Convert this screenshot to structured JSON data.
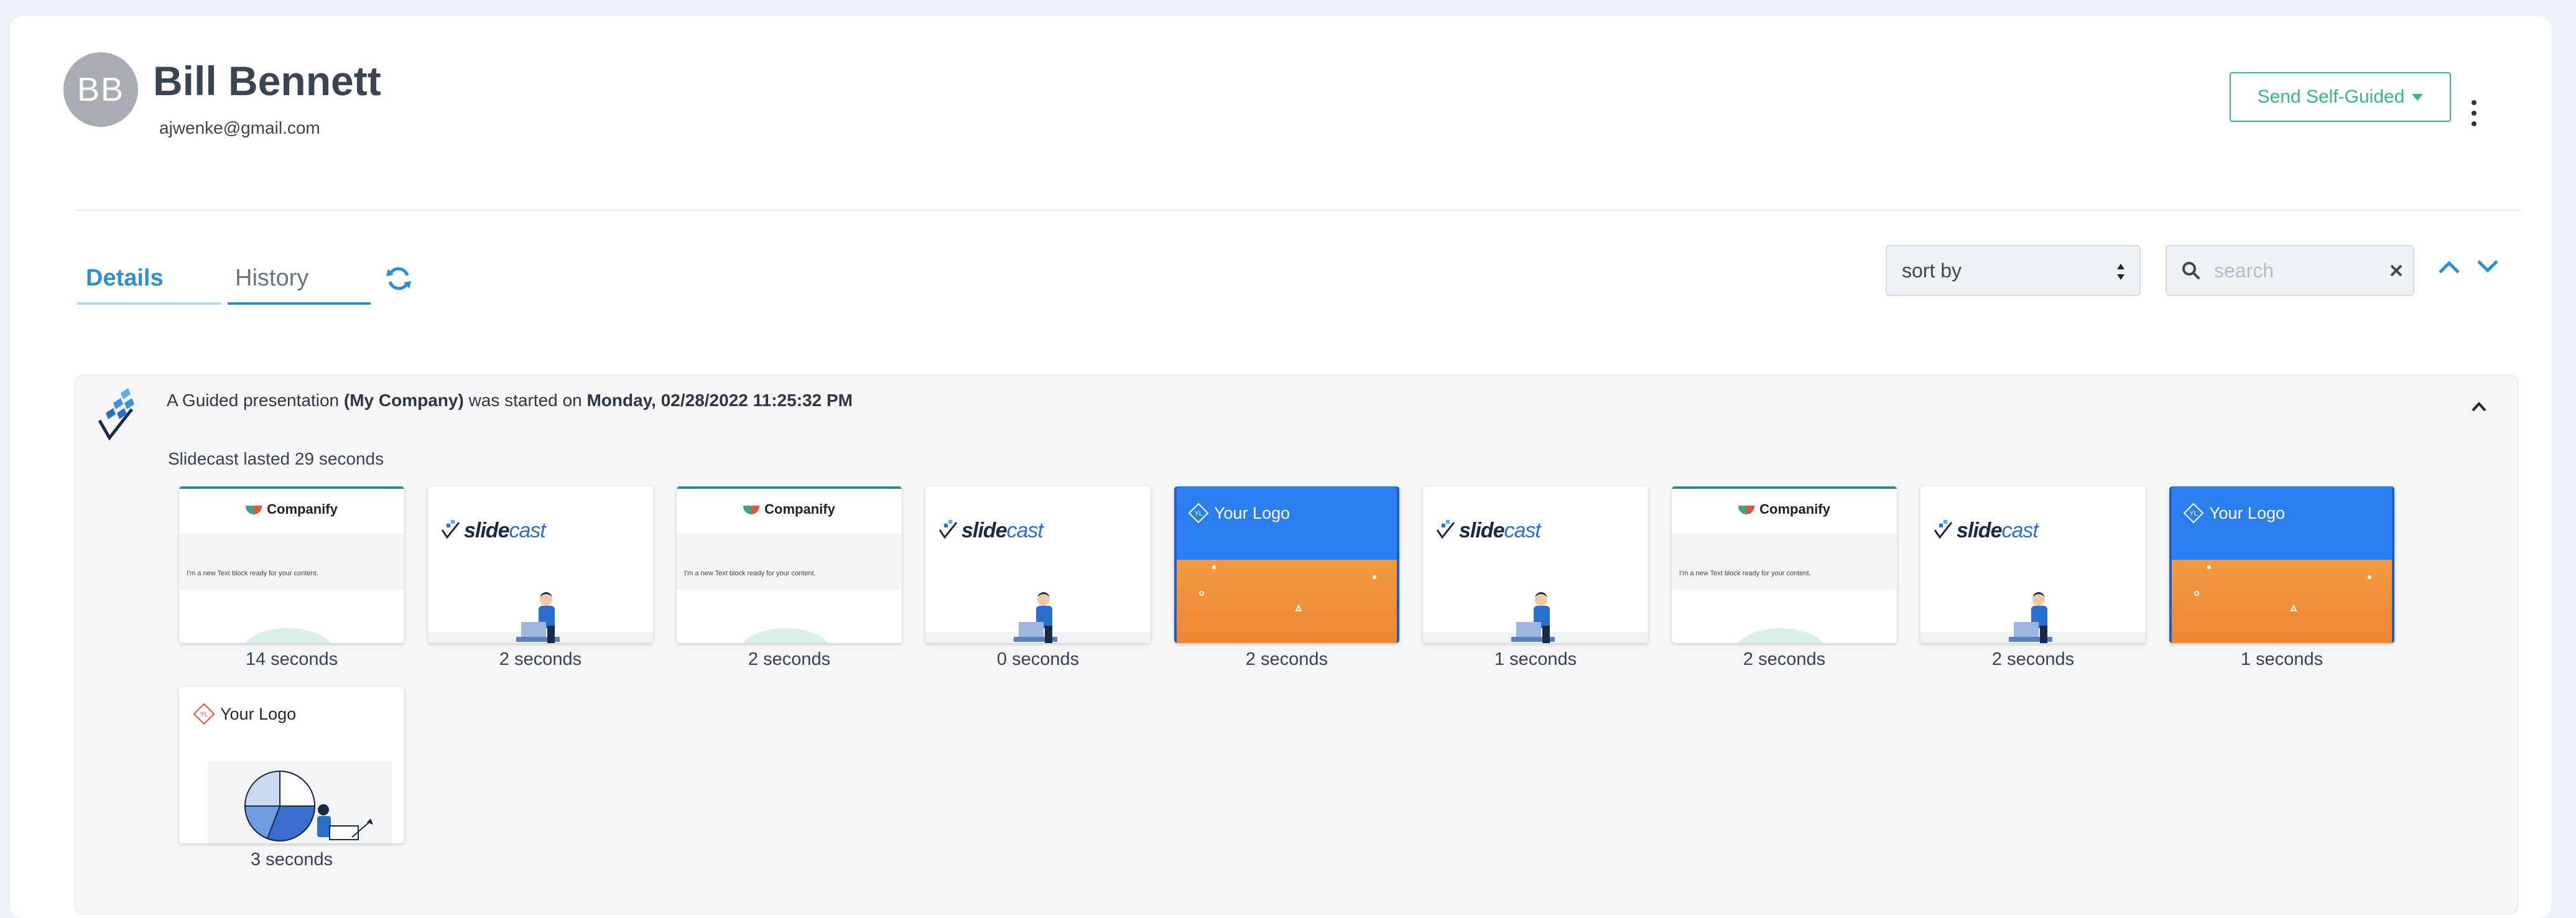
{
  "user": {
    "initials": "BB",
    "name": "Bill Bennett",
    "email": "ajwenke@gmail.com"
  },
  "header": {
    "send_button_label": "Send Self-Guided",
    "more_icon": "kebab-vertical-icon"
  },
  "tabs": [
    {
      "label": "Details",
      "active": false
    },
    {
      "label": "History",
      "active": true
    }
  ],
  "toolbar": {
    "refresh_icon": "refresh-icon",
    "sort": {
      "selected": "sort by"
    },
    "search": {
      "value": "",
      "placeholder": "search"
    }
  },
  "activity": {
    "prefix": "A Guided presentation",
    "company": "(My Company)",
    "middle": "was started on",
    "datetime": "Monday, 02/28/2022 11:25:32 PM",
    "duration": "Slidecast lasted 29 seconds",
    "slides": [
      {
        "type": "companify",
        "label": "14 seconds",
        "logo": "Companify",
        "body": "I'm a new Text block ready for your content."
      },
      {
        "type": "slidecast",
        "label": "2 seconds",
        "brand_a": "slide",
        "brand_b": "cast"
      },
      {
        "type": "companify",
        "label": "2 seconds",
        "logo": "Companify",
        "body": "I'm a new Text block ready for your content."
      },
      {
        "type": "slidecast",
        "label": "0 seconds",
        "brand_a": "slide",
        "brand_b": "cast"
      },
      {
        "type": "yourlogo",
        "label": "2 seconds",
        "logo": "Your Logo",
        "badge": "YL"
      },
      {
        "type": "slidecast",
        "label": "1 seconds",
        "brand_a": "slide",
        "brand_b": "cast"
      },
      {
        "type": "companify",
        "label": "2 seconds",
        "logo": "Companify",
        "body": "I'm a new Text block ready for your content."
      },
      {
        "type": "slidecast",
        "label": "2 seconds",
        "brand_a": "slide",
        "brand_b": "cast"
      },
      {
        "type": "yourlogo",
        "label": "1 seconds",
        "logo": "Your Logo",
        "badge": "YL"
      },
      {
        "type": "piechart",
        "label": "3 seconds",
        "logo": "Your Logo",
        "badge": "YL"
      }
    ]
  },
  "colors": {
    "accent_blue": "#2b8fd6",
    "accent_green": "#33b88b",
    "slide_blue": "#2a7ef0",
    "slide_orange": "#f08a3a"
  }
}
